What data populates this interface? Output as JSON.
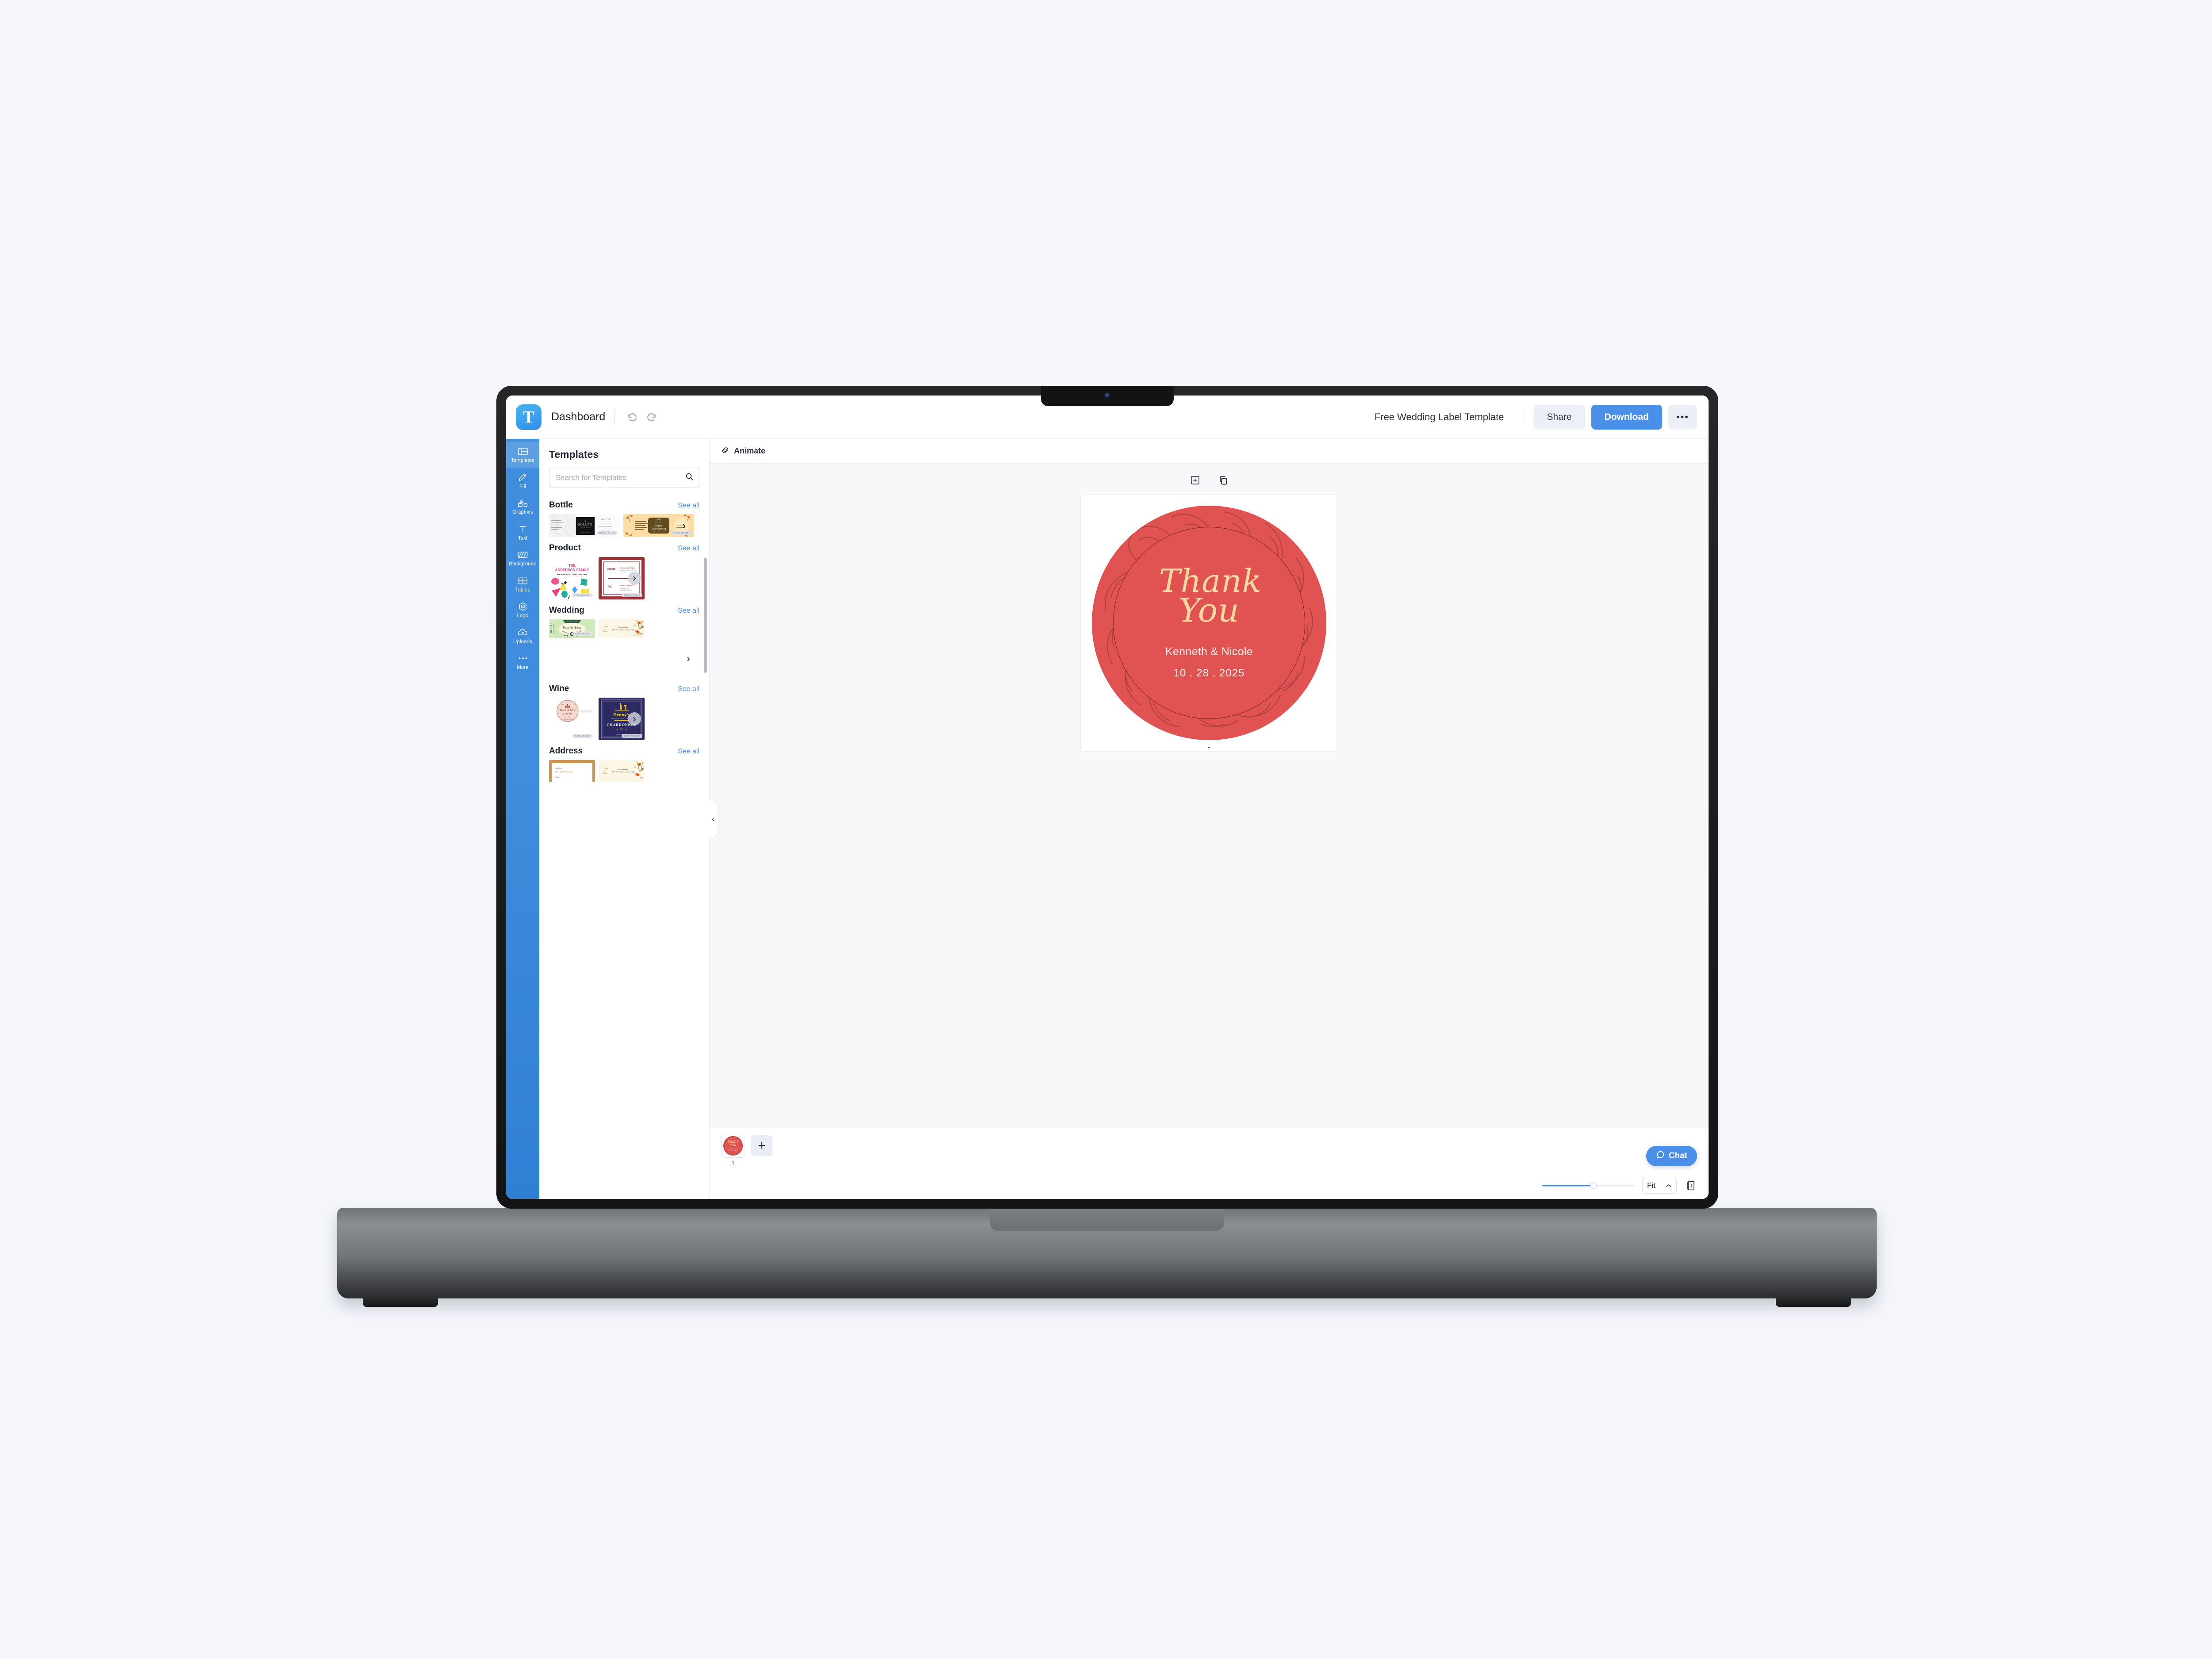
{
  "app": {
    "logo_letter": "T",
    "dashboard_label": "Dashboard",
    "doc_title": "Free Wedding Label Template",
    "share_label": "Share",
    "download_label": "Download",
    "more_label": "•••",
    "accent_color": "#4a90e8",
    "rail_color": "#3f8ddc"
  },
  "rail": {
    "items": [
      {
        "label": "Templates",
        "icon": "layout-icon",
        "active": true
      },
      {
        "label": "Fill",
        "icon": "pencil-icon",
        "active": false
      },
      {
        "label": "Graphics",
        "icon": "shapes-icon",
        "active": false
      },
      {
        "label": "Text",
        "icon": "text-t-icon",
        "active": false
      },
      {
        "label": "Background",
        "icon": "background-icon",
        "active": false
      },
      {
        "label": "Tables",
        "icon": "table-grid-icon",
        "active": false
      },
      {
        "label": "Logo",
        "icon": "logo-hexagon-icon",
        "active": false
      },
      {
        "label": "Uploads",
        "icon": "cloud-upload-icon",
        "active": false
      },
      {
        "label": "More",
        "icon": "ellipsis-icon",
        "active": false
      }
    ]
  },
  "panel": {
    "title": "Templates",
    "search_placeholder": "Search for Templates",
    "search_value": "",
    "see_all_label": "See all",
    "categories": [
      {
        "name": "Bottle",
        "templates": [
          {
            "kind": "marble-solute",
            "brand": "SOLUTE",
            "sub": "LIQUID SOAP",
            "badge": "TEMPLATE.NET"
          },
          {
            "kind": "thanksgiving",
            "title": "Happy Thanksgiving",
            "brand": "HIGH STAR",
            "badge": "TEMPLATE.NET"
          }
        ]
      },
      {
        "name": "Product",
        "templates": [
          {
            "kind": "anderson",
            "line1": "THE",
            "line2": "ANDERSON FAMILY",
            "line3": "PHOTO ALBUM • CHRISTMAS 2025",
            "badge": "TEMPLATE.NET"
          },
          {
            "kind": "shipping",
            "from_label": "FROM:",
            "from_name": "Cannon Auto Repair",
            "from_addr": "34 Greenwich St North Hampton, TX 56474",
            "to_label": "TO:",
            "to_name": "Ethan D. William",
            "to_addr": "92 SE Minter Drive, Grand Rapids, MI 49503",
            "badge": "TEMPLATE.NET"
          }
        ]
      },
      {
        "name": "Wedding",
        "templates": [
          {
            "kind": "paul-anna",
            "names": "Paul & Anna",
            "date": "07 . 17 . 2025",
            "side": "FALL IN LOVE DEEPER",
            "badge": "TEMPLATE.NET"
          },
          {
            "kind": "john-dena",
            "script": "John & Dena",
            "venue": "Green House",
            "addr": "1234 Main Street , Newyork City"
          }
        ]
      },
      {
        "name": "Wine",
        "templates": [
          {
            "kind": "pierre-circle",
            "name1": "Pierre-Antoine",
            "name2": "Carillon",
            "sub": "Dom / Vintage",
            "sub2": "Wine in Red after dinner drink",
            "badge": "TEMPLATE.NET"
          },
          {
            "kind": "dennys-chardonnay",
            "brand": "Denny's",
            "brand_sub": "WINE DISTILLERY",
            "variety": "CHARDONNAY",
            "year": "1899",
            "site": "dennysweinedistillery.com",
            "badge": "TEMPLATE.NET"
          }
        ]
      },
      {
        "name": "Address",
        "templates": [
          {
            "kind": "cork-address",
            "line1": "Address",
            "line2": "Book Label Template",
            "line3": "Name"
          },
          {
            "kind": "john-dena",
            "script": "John & Dena",
            "venue": "Green House",
            "addr": "1234 Main Street , Newyork City"
          }
        ]
      }
    ]
  },
  "editor": {
    "animate_label": "Animate",
    "add_page_icon": "add-square-icon",
    "duplicate_icon": "duplicate-icon",
    "collapse_left_icon": "chevron-left-icon",
    "collapse_down_icon": "chevron-down-icon"
  },
  "design": {
    "thank_line1": "Thank",
    "thank_line2": "You",
    "couple": "Kenneth & Nicole",
    "date": "10 . 28 . 2025",
    "label_red": "#e05352",
    "text_cream": "#fad8a0",
    "ring_color": "#6f2326"
  },
  "pages": {
    "page_number": "1",
    "add_page_label": "+"
  },
  "bottom": {
    "zoom_value": "Fit",
    "zoom_percent": 55,
    "chat_label": "Chat",
    "pages_count": "1"
  }
}
